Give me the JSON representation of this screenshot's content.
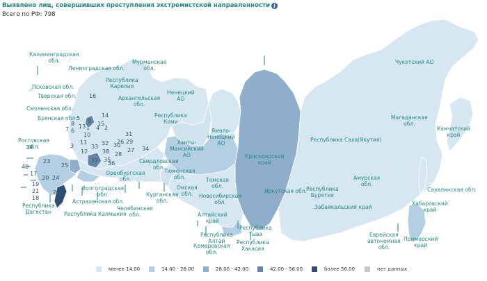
{
  "title": "Выявлено лиц, совершивших преступления экстремистской направленности",
  "info_icon": "info-icon",
  "total": "Всего по РФ: 798",
  "colors": {
    "c0": "#d6e7f2",
    "c1": "#b4cfe4",
    "c2": "#8eaecb",
    "c3": "#6485a8",
    "c4": "#2f4e74",
    "nodata": "#c8c8c8",
    "label": "#1f8a82",
    "leader": "#3a9c8f"
  },
  "regions": {
    "kaliningrad": "Калининградская\nобл.",
    "leningrad": "Ленинградская обл.",
    "murmansk": "Мурманская\nобл.",
    "karelia": "Республика\nКарелия",
    "pskov": "Псковская обл.",
    "tver": "Тверская обл.",
    "smolensk": "Смоленская обл.",
    "bryansk": "Брянская обл.",
    "arkhangelsk": "Архангельская\nобл.",
    "nenets": "Ненецкий\nАО",
    "komi": "Республика\nКоми",
    "yamal": "Ямало-\nНенецкий\nАО",
    "khanty": "Ханты-\nМансийский\nАО",
    "krasnoyarsk": "Красноярский\nкрай",
    "sakha": "Республика Саха(Якутия)",
    "chukotka": "Чукотский АО",
    "magadan": "Магаданская\nобл.",
    "kamchatka": "Камчатский\nкрай",
    "sakhalin": "Сахалинская обл.",
    "khabarovsk": "Хабаровский\nкрай",
    "amur": "Амурская\nобл.",
    "zabaikal": "Забайкальский край",
    "buryatia": "Республика\nБурятия",
    "irkutsk": "Иркутская обл.",
    "rostov": "Ростовская\nобл.",
    "sverdlovsk": "Свердловская\nобл.",
    "tyumen": "Тюменская\nобл.",
    "tomsk": "Томская\nобл.",
    "omsk": "Омская\nобл.",
    "novosibirsk": "Новосибирская\nобл.",
    "orenburg": "Оренбургская\nобл.",
    "volgograd": "Волгоградская\nобл.",
    "astrakhan": "Астраханская обл.",
    "kurgan": "Курганская\nобл.",
    "chelyabinsk": "Челябинская\nобл.",
    "kalmykia": "Республика Калмыкия",
    "dagestan": "Республика\nДагестан",
    "altai_krai": "Алтайский\nкрай",
    "altai_rep": "Республика\nАлтай",
    "kemerovo": "Кемеровская\nобл.",
    "tyva": "Республика\nТыва",
    "khakassia": "Республика\nХакасия",
    "evrei": "Еврейская\nавтономная\nобл.",
    "primorye": "Приморский\nкрай"
  },
  "map_numbers": [
    "16",
    "14",
    "15",
    "5",
    "9",
    "4",
    "8",
    "6",
    "13",
    "1",
    "2",
    "3",
    "7",
    "10",
    "11",
    "12",
    "33",
    "37",
    "38",
    "32",
    "30",
    "31",
    "26",
    "28",
    "27",
    "29",
    "34",
    "35",
    "36",
    "39",
    "40",
    "17",
    "19",
    "20",
    "21",
    "22",
    "23",
    "24",
    "25",
    "18"
  ],
  "legend": [
    {
      "label": "менее 14.00",
      "color_key": "c0"
    },
    {
      "label": "14.00 - 28.00",
      "color_key": "c1"
    },
    {
      "label": "28.00 - 42.00",
      "color_key": "c2"
    },
    {
      "label": "42.00 - 56.00",
      "color_key": "c3"
    },
    {
      "label": "более 56.00",
      "color_key": "c4"
    },
    {
      "label": "нет данных",
      "color_key": "nodata"
    }
  ]
}
